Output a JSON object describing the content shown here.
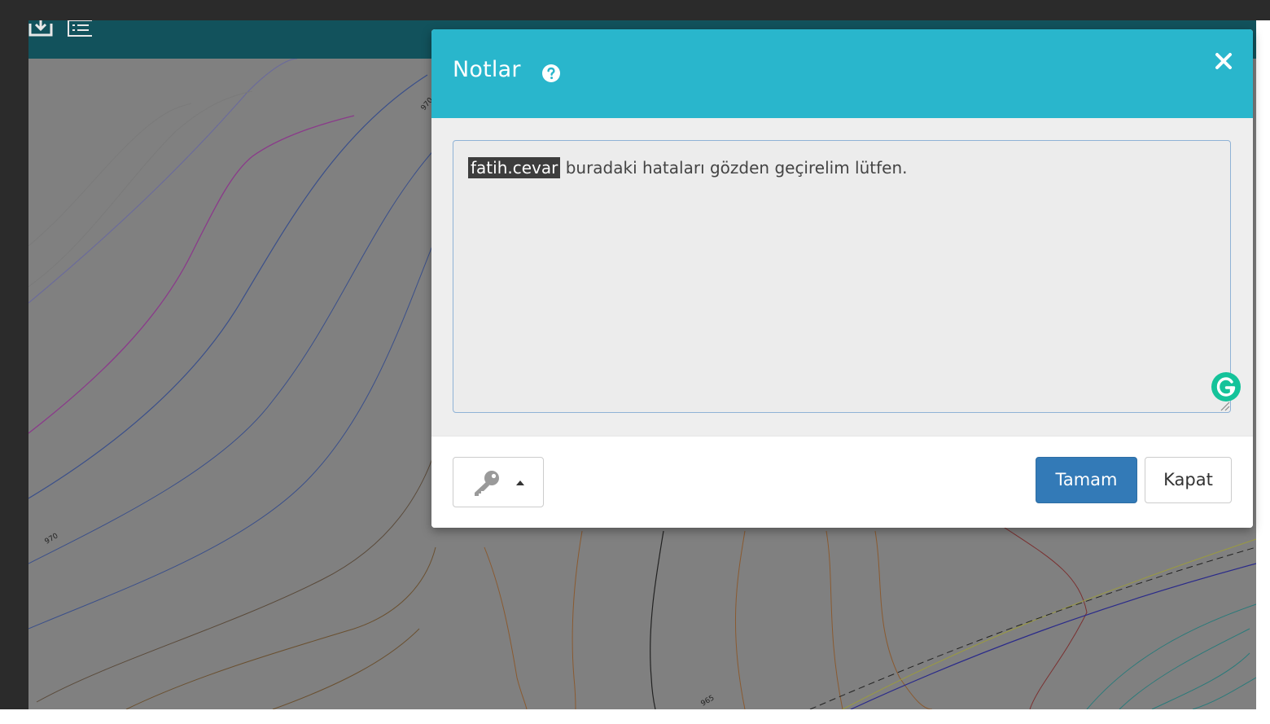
{
  "modal": {
    "title": "Notlar",
    "note": {
      "mention": "fatih.cevar",
      "text": " buradaki hataları gözden geçirelim lütfen."
    },
    "ok_label": "Tamam",
    "close_label": "Kapat"
  },
  "map_labels": {
    "contour_1": "970",
    "contour_2": "970",
    "contour_3": "965"
  },
  "colors": {
    "toolbar": "#12525c",
    "header": "#29b6cc",
    "primary_button": "#337ab7",
    "grammarly": "#15c39a"
  },
  "icons": {
    "download": "download-icon",
    "list": "list-icon",
    "help": "question-circle-icon",
    "close": "close-icon",
    "key": "key-icon",
    "caret": "caret-up-icon",
    "grammarly": "grammarly-icon"
  }
}
